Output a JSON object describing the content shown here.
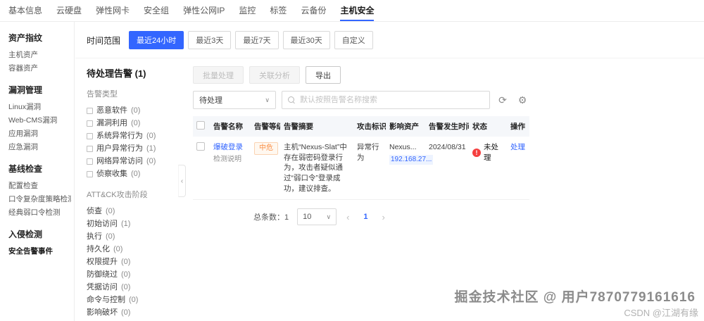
{
  "topnav": {
    "tabs": [
      {
        "label": "基本信息"
      },
      {
        "label": "云硬盘"
      },
      {
        "label": "弹性网卡"
      },
      {
        "label": "安全组"
      },
      {
        "label": "弹性公网IP"
      },
      {
        "label": "监控"
      },
      {
        "label": "标签"
      },
      {
        "label": "云备份"
      },
      {
        "label": "主机安全"
      }
    ]
  },
  "sidebar": {
    "sections": [
      {
        "title": "资产指纹",
        "items": [
          "主机资产",
          "容器资产"
        ]
      },
      {
        "title": "漏洞管理",
        "items": [
          "Linux漏洞",
          "Web-CMS漏洞",
          "应用漏洞",
          "应急漏洞"
        ]
      },
      {
        "title": "基线检查",
        "items": [
          "配置检查",
          "口令复杂度策略检测",
          "经典弱口令检测"
        ]
      },
      {
        "title": "入侵检测",
        "items": [
          "安全告警事件"
        ]
      }
    ]
  },
  "timebar": {
    "label": "时间范围",
    "options": [
      "最近24小时",
      "最近3天",
      "最近7天",
      "最近30天",
      "自定义"
    ]
  },
  "alerts": {
    "title": "待处理告警 (1)",
    "filters": [
      {
        "title": "告警类型",
        "items": [
          {
            "label": "恶意软件",
            "count": "(0)"
          },
          {
            "label": "漏洞利用",
            "count": "(0)"
          },
          {
            "label": "系统异常行为",
            "count": "(0)"
          },
          {
            "label": "用户异常行为",
            "count": "(1)"
          },
          {
            "label": "网络异常访问",
            "count": "(0)"
          },
          {
            "label": "侦察收集",
            "count": "(0)"
          }
        ]
      },
      {
        "title": "ATT&CK攻击阶段",
        "items": [
          {
            "label": "侦查",
            "count": "(0)"
          },
          {
            "label": "初始访问",
            "count": "(1)"
          },
          {
            "label": "执行",
            "count": "(0)"
          },
          {
            "label": "持久化",
            "count": "(0)"
          },
          {
            "label": "权限提升",
            "count": "(0)"
          },
          {
            "label": "防御绕过",
            "count": "(0)"
          },
          {
            "label": "凭据访问",
            "count": "(0)"
          },
          {
            "label": "命令与控制",
            "count": "(0)"
          },
          {
            "label": "影响破坏",
            "count": "(0)"
          }
        ]
      }
    ],
    "toolbar": {
      "batch_button": "批量处理",
      "analyze_button": "关联分析",
      "export_button": "导出"
    },
    "search": {
      "status_filter": "待处理",
      "placeholder": "默认按照告警名称搜索"
    },
    "table": {
      "headers": [
        "告警名称",
        "告警等级",
        "告警摘要",
        "攻击标识",
        "影响资产",
        "告警发生时间",
        "状态",
        "操作"
      ],
      "row": {
        "name": "爆破登录",
        "name_sub": "检测说明",
        "severity": "中危",
        "summary": "主机“Nexus-Slat”中存在弱密码登录行为，攻击者疑似通过“弱口令”登录成功，建议排查。",
        "attack_tag": "异常行为",
        "asset": "Nexus...",
        "asset_ip": "192.168.27...",
        "time": "2024/08/31",
        "status": "未处理",
        "action": "处理"
      }
    },
    "pagination": {
      "total_label": "总条数：1",
      "page_size": "10",
      "current_page": "1"
    }
  },
  "watermark": {
    "line1": "掘金技术社区 @ 用户7870779161616",
    "line2": "CSDN @江湖有缘"
  },
  "icons": {
    "refresh": "⟳",
    "settings": "⚙",
    "caret_down": "∨",
    "chevron_left": "‹",
    "chevron_right": "›",
    "collapse_left": "‹",
    "status_error": "!"
  },
  "colors": {
    "accent": "#3366ff",
    "severity_medium": "#fa8e45",
    "status_error": "#f53f3f"
  }
}
